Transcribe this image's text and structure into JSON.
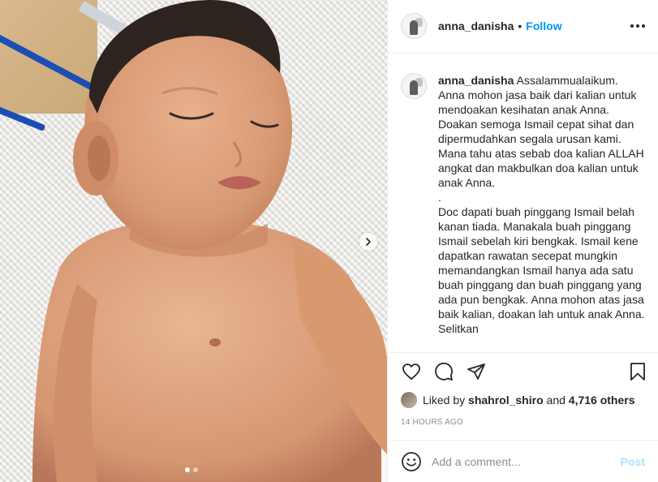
{
  "post": {
    "username": "anna_danisha",
    "separator": "•",
    "follow_label": "Follow",
    "more_icon": "more-horizontal-icon"
  },
  "caption": {
    "username": "anna_danisha",
    "paragraph_1": "Assalammualaikum. Anna mohon jasa baik dari kalian untuk mendoakan kesihatan anak Anna. Doakan semoga Ismail cepat sihat dan dipermudahkan segala urusan kami. Mana tahu atas sebab doa kalian ALLAH angkat dan makbulkan doa kalian untuk anak Anna.",
    "paragraph_2": ".",
    "paragraph_3": "Doc dapati buah pinggang Ismail belah kanan tiada. Manakala buah pinggang Ismail sebelah kiri bengkak. Ismail kene dapatkan rawatan secepat mungkin memandangkan Ismail hanya ada satu buah pinggang dan buah pinggang yang ada pun bengkak. Anna mohon atas jasa baik kalian, doakan lah untuk anak Anna. Selitkan"
  },
  "actions": {
    "like_icon": "heart-icon",
    "comment_icon": "comment-icon",
    "share_icon": "share-icon",
    "save_icon": "bookmark-icon"
  },
  "likes": {
    "prefix": "Liked by ",
    "liker": "shahrol_shiro",
    "middle": " and ",
    "others": "4,716 others"
  },
  "timestamp": "14 HOURS AGO",
  "comment": {
    "placeholder": "Add a comment...",
    "post_label": "Post",
    "emoji_icon": "smiley-icon"
  },
  "carousel": {
    "total_slides": 2,
    "active_slide": 1,
    "next_icon": "chevron-right-icon"
  },
  "colors": {
    "accent": "#0095f6",
    "post_disabled": "#b2dffc",
    "muted_text": "#8e8e8e",
    "text": "#262626",
    "border": "#efefef"
  }
}
